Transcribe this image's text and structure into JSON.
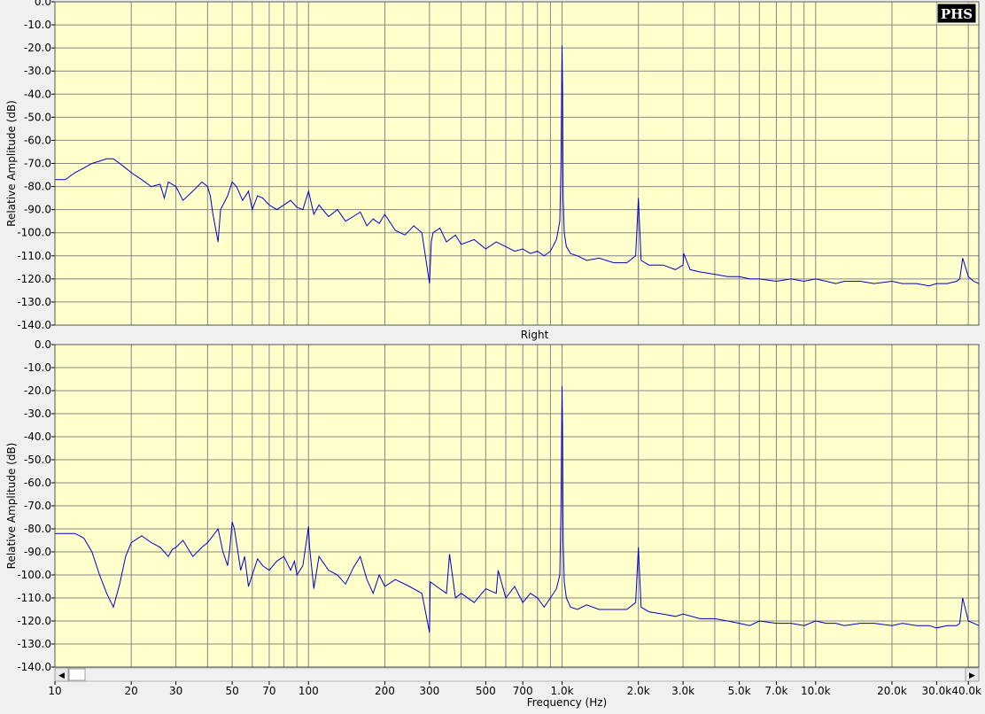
{
  "watermark": "PHS",
  "colors": {
    "plot_bg": "#ffffcc",
    "grid": "#878787",
    "trace": "#0000cc",
    "frame": "#555555",
    "scroll_bg": "#f0f0f0"
  },
  "scrollbar": {
    "left_arrow": "◀",
    "right_arrow": "▶",
    "position": 0.0
  },
  "chart_data": [
    {
      "type": "line",
      "title": "",
      "xlabel": "",
      "ylabel": "Relative Amplitude (dB)",
      "x_scale": "log",
      "xlim": [
        10,
        44000
      ],
      "ylim": [
        -140,
        0
      ],
      "grid": true,
      "yticks": [
        "0.0",
        "-10.0",
        "-20.0",
        "-30.0",
        "-40.0",
        "-50.0",
        "-60.0",
        "-70.0",
        "-80.0",
        "-90.0",
        "-100.0",
        "-110.0",
        "-120.0",
        "-130.0",
        "-140.0"
      ],
      "series": [
        {
          "x": [
            10,
            11,
            12,
            13,
            14,
            15,
            16,
            17,
            18,
            19,
            20,
            22,
            24,
            26,
            27,
            28,
            30,
            32,
            35,
            38,
            40,
            41,
            42,
            43,
            44,
            45,
            46,
            48,
            50,
            52,
            55,
            58,
            60,
            63,
            66,
            70,
            75,
            80,
            85,
            90,
            95,
            100,
            105,
            110,
            120,
            130,
            140,
            150,
            160,
            170,
            180,
            190,
            200,
            220,
            240,
            260,
            280,
            300,
            305,
            310,
            330,
            350,
            380,
            400,
            450,
            500,
            550,
            600,
            650,
            700,
            750,
            800,
            850,
            900,
            950,
            980,
            990,
            1000,
            1005,
            1010,
            1020,
            1040,
            1080,
            1150,
            1250,
            1400,
            1600,
            1800,
            1950,
            2000,
            2050,
            2200,
            2500,
            2800,
            3000,
            3020,
            3200,
            3500,
            4000,
            4500,
            5000,
            5500,
            6000,
            7000,
            8000,
            9000,
            10000,
            11000,
            12000,
            13000,
            15000,
            17000,
            20000,
            22000,
            25000,
            28000,
            30000,
            33000,
            36000,
            37000,
            38000,
            40000,
            42000,
            44000
          ],
          "y": [
            -77,
            -77,
            -74,
            -72,
            -70,
            -69,
            -68,
            -68,
            -70,
            -72,
            -74,
            -77,
            -80,
            -79,
            -85,
            -78,
            -80,
            -86,
            -82,
            -78,
            -80,
            -84,
            -92,
            -98,
            -104,
            -90,
            -88,
            -84,
            -78,
            -80,
            -86,
            -82,
            -90,
            -84,
            -85,
            -88,
            -90,
            -88,
            -86,
            -89,
            -90,
            -82,
            -92,
            -88,
            -93,
            -90,
            -95,
            -93,
            -91,
            -97,
            -94,
            -96,
            -92,
            -99,
            -101,
            -97,
            -100,
            -122,
            -104,
            -100,
            -98,
            -104,
            -101,
            -105,
            -103,
            -107,
            -104,
            -106,
            -108,
            -107,
            -109,
            -108,
            -110,
            -108,
            -103,
            -95,
            -70,
            -19,
            -40,
            -85,
            -100,
            -106,
            -109,
            -110,
            -112,
            -111,
            -113,
            -113,
            -110,
            -85,
            -112,
            -114,
            -114,
            -116,
            -114,
            -109,
            -116,
            -117,
            -118,
            -119,
            -119,
            -120,
            -120,
            -121,
            -120,
            -121,
            -120,
            -121,
            -122,
            -121,
            -121,
            -122,
            -121,
            -122,
            -122,
            -123,
            -122,
            -122,
            -121,
            -120,
            -111,
            -119,
            -121,
            -122
          ]
        }
      ]
    },
    {
      "type": "line",
      "title": "Right",
      "xlabel": "Frequency (Hz)",
      "ylabel": "Relative Amplitude (dB)",
      "x_scale": "log",
      "xlim": [
        10,
        44000
      ],
      "ylim": [
        -140,
        0
      ],
      "grid": true,
      "xticks": [
        "10",
        "20",
        "30",
        "50",
        "70",
        "100",
        "200",
        "300",
        "500",
        "700",
        "1.0k",
        "2.0k",
        "3.0k",
        "5.0k",
        "7.0k",
        "10.0k",
        "20.0k",
        "30.0k",
        "40.0k"
      ],
      "yticks": [
        "0.0",
        "-10.0",
        "-20.0",
        "-30.0",
        "-40.0",
        "-50.0",
        "-60.0",
        "-70.0",
        "-80.0",
        "-90.0",
        "-100.0",
        "-110.0",
        "-120.0",
        "-130.0",
        "-140.0"
      ],
      "series": [
        {
          "x": [
            10,
            11,
            12,
            13,
            14,
            15,
            16,
            17,
            18,
            19,
            20,
            22,
            24,
            26,
            28,
            29,
            30,
            32,
            35,
            38,
            40,
            42,
            44,
            46,
            48,
            49,
            50,
            51,
            52,
            54,
            56,
            58,
            60,
            63,
            66,
            70,
            75,
            80,
            85,
            88,
            90,
            95,
            100,
            101,
            105,
            110,
            120,
            130,
            140,
            150,
            160,
            170,
            180,
            190,
            200,
            220,
            250,
            280,
            300,
            302,
            320,
            350,
            360,
            380,
            400,
            450,
            500,
            550,
            560,
            600,
            650,
            700,
            750,
            800,
            850,
            900,
            950,
            980,
            990,
            1000,
            1005,
            1010,
            1020,
            1040,
            1080,
            1150,
            1250,
            1400,
            1600,
            1800,
            1950,
            2000,
            2050,
            2200,
            2500,
            2800,
            3000,
            3500,
            4000,
            4500,
            5000,
            5500,
            6000,
            7000,
            8000,
            9000,
            10000,
            11000,
            12000,
            13000,
            15000,
            17000,
            20000,
            22000,
            25000,
            28000,
            30000,
            33000,
            36000,
            37000,
            38000,
            40000,
            42000,
            44000
          ],
          "y": [
            -82,
            -82,
            -82,
            -84,
            -90,
            -100,
            -108,
            -114,
            -104,
            -92,
            -86,
            -83,
            -86,
            -88,
            -92,
            -89,
            -88,
            -85,
            -92,
            -88,
            -86,
            -83,
            -80,
            -90,
            -96,
            -88,
            -77,
            -80,
            -86,
            -98,
            -92,
            -105,
            -100,
            -93,
            -96,
            -98,
            -94,
            -92,
            -98,
            -94,
            -100,
            -96,
            -79,
            -88,
            -106,
            -92,
            -98,
            -100,
            -104,
            -97,
            -92,
            -102,
            -108,
            -100,
            -105,
            -102,
            -105,
            -108,
            -125,
            -103,
            -105,
            -108,
            -91,
            -110,
            -108,
            -112,
            -106,
            -108,
            -98,
            -110,
            -105,
            -112,
            -108,
            -110,
            -114,
            -110,
            -106,
            -100,
            -70,
            -18,
            -40,
            -85,
            -103,
            -110,
            -114,
            -115,
            -113,
            -115,
            -115,
            -115,
            -112,
            -88,
            -114,
            -116,
            -117,
            -118,
            -117,
            -119,
            -119,
            -120,
            -121,
            -122,
            -120,
            -121,
            -121,
            -122,
            -120,
            -121,
            -121,
            -122,
            -121,
            -121,
            -122,
            -121,
            -122,
            -122,
            -123,
            -122,
            -122,
            -121,
            -110,
            -120,
            -121,
            -122
          ]
        }
      ]
    }
  ]
}
